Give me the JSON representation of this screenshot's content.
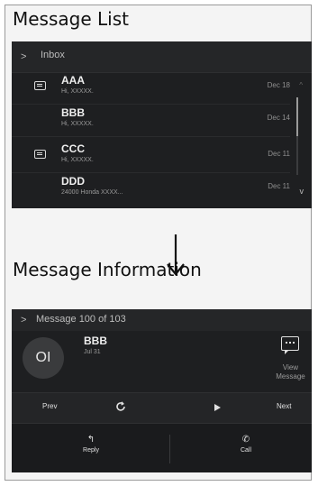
{
  "message_list": {
    "title": "Message List",
    "header": {
      "chevron": ">",
      "label": "Inbox"
    },
    "messages": [
      {
        "sender": "AAA",
        "preview": "Hi, XXXXX.",
        "date": "Dec 18",
        "unread": true
      },
      {
        "sender": "BBB",
        "preview": "Hi, XXXXX.",
        "date": "Dec 14",
        "unread": false
      },
      {
        "sender": "CCC",
        "preview": "Hi, XXXXX.",
        "date": "Dec 11",
        "unread": true
      },
      {
        "sender": "DDD",
        "preview": "24000 Honda XXXX...",
        "date": "Dec 11",
        "unread": false
      }
    ],
    "scroll": {
      "up": "^",
      "down": "v",
      "position": 0.0,
      "visible_fraction": 0.5
    }
  },
  "arrow": {
    "glyph": "↓",
    "icon": "down-arrow-icon"
  },
  "message_info": {
    "title": "Message Information",
    "header": {
      "chevron": ">",
      "label": "Message 100 of 103"
    },
    "avatar_initials": "OI",
    "sender": "BBB",
    "date": "Jul 31",
    "view_label": "View Message",
    "controls": {
      "prev": "Prev",
      "refresh_icon": "refresh-icon",
      "play_icon": "play-icon",
      "next": "Next"
    },
    "actions": {
      "reply": "Reply",
      "reply_icon": "reply-icon",
      "call": "Call",
      "call_icon": "phone-icon"
    }
  },
  "colors": {
    "screen_bg": "#1e1f21",
    "header_bg": "#252628",
    "text": "#dcdcdc",
    "muted": "#9a9a9a"
  }
}
